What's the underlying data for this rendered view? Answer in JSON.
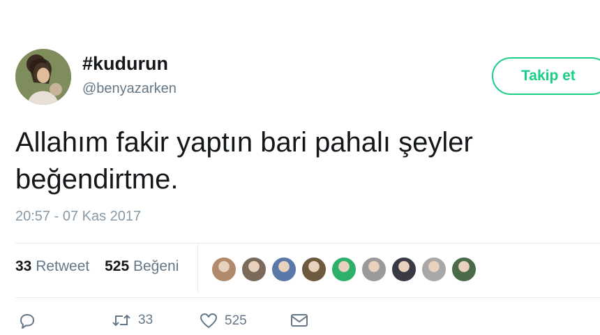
{
  "tweet": {
    "display_name": "#kudurun",
    "username": "@benyazarken",
    "follow_label": "Takip et",
    "text": "Allahım fakir yaptın bari pahalı şeyler beğendirtme.",
    "timestamp": "20:57 - 07 Kas 2017"
  },
  "stats": {
    "retweet_count": "33",
    "retweet_label": "Retweet",
    "like_count": "525",
    "like_label": "Beğeni"
  },
  "likers": [
    {
      "color": "#b08a6a"
    },
    {
      "color": "#7a6a5c"
    },
    {
      "color": "#5a78a8"
    },
    {
      "color": "#6d5a3e"
    },
    {
      "color": "#2fb06a"
    },
    {
      "color": "#9a9a9a"
    },
    {
      "color": "#3a3a44"
    },
    {
      "color": "#a8a8a8"
    },
    {
      "color": "#4a6a4a"
    }
  ],
  "actions": {
    "reply_icon": "reply-icon",
    "retweet_icon": "retweet-icon",
    "retweet_count": "33",
    "like_icon": "heart-icon",
    "like_count": "525",
    "dm_icon": "envelope-icon"
  },
  "colors": {
    "accent": "#19cf86",
    "secondary_text": "#657786"
  }
}
